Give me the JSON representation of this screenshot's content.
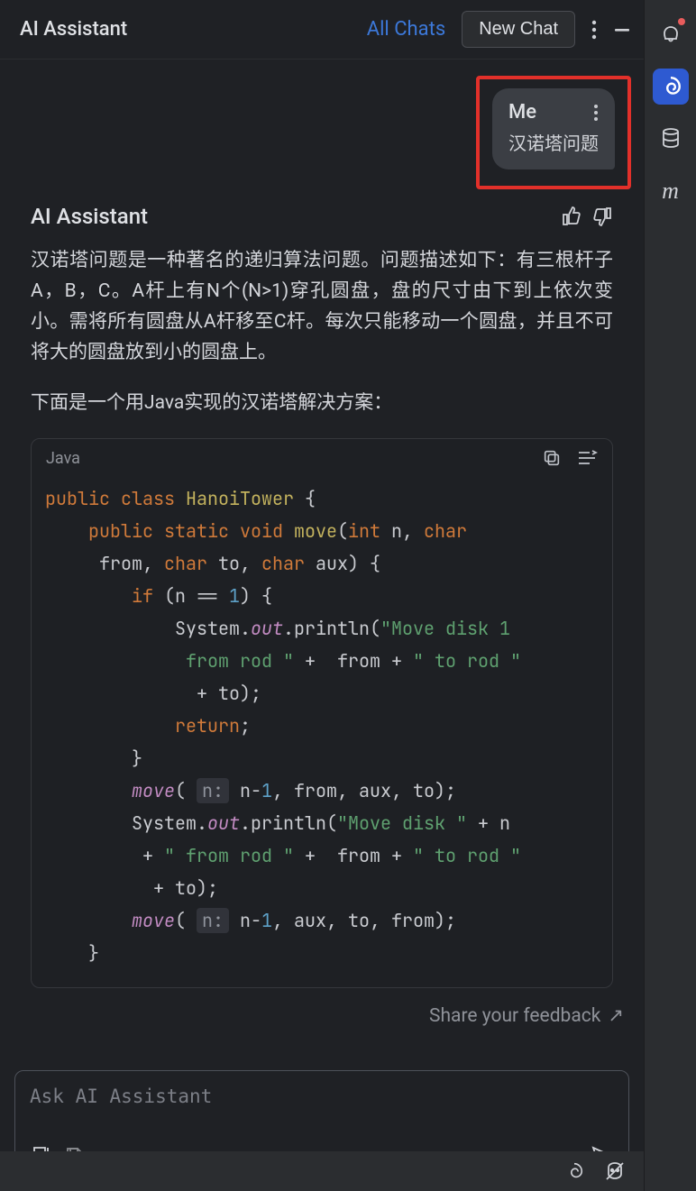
{
  "header": {
    "title": "AI Assistant",
    "all_chats": "All Chats",
    "new_chat": "New Chat"
  },
  "user_message": {
    "sender": "Me",
    "text": "汉诺塔问题"
  },
  "assistant_message": {
    "sender": "AI Assistant",
    "paragraph1": "汉诺塔问题是一种著名的递归算法问题。问题描述如下：有三根杆子A，B，C。A杆上有N个(N>1)穿孔圆盘，盘的尺寸由下到上依次变小。需将所有圆盘从A杆移至C杆。每次只能移动一个圆盘，并且不可将大的圆盘放到小的圆盘上。",
    "paragraph2": "下面是一个用Java实现的汉诺塔解决方案：",
    "code": {
      "lang": "Java",
      "kw_public": "public",
      "kw_class": "class",
      "cls_name": "HanoiTower",
      "kw_static": "static",
      "kw_void": "void",
      "fn_move": "move",
      "kw_int": "int",
      "kw_char": "char",
      "kw_if": "if",
      "kw_return": "return",
      "field_out": "out",
      "num_1": "1",
      "hint_n": "n:",
      "text_n": "n",
      "text_from": "from",
      "text_to": "to",
      "text_aux": "aux",
      "text_System": "System",
      "text_println": "println",
      "str_move_disk_1_from_rod": "\"Move disk 1 from rod \"",
      "str_to_rod": "\" to rod \"",
      "str_move_disk": "\"Move disk \"",
      "str_from_rod": "\" from rod \"",
      "text_nminus": "n-",
      "text_plus": "+",
      "text_eqeq": "==",
      "text_comma": ",",
      "text_lparen": "(",
      "text_rparen": ")",
      "text_lbrace": "{",
      "text_rbrace": "}",
      "text_semi": ";"
    }
  },
  "feedback_link": "Share your feedback",
  "input": {
    "placeholder": "Ask AI Assistant"
  },
  "sidebar": {
    "icons": [
      "notifications-icon",
      "ai-assistant-icon",
      "database-icon",
      "maven-icon"
    ]
  },
  "statusbar": {
    "icons": [
      "spiral-icon",
      "copilot-disabled-icon"
    ]
  }
}
